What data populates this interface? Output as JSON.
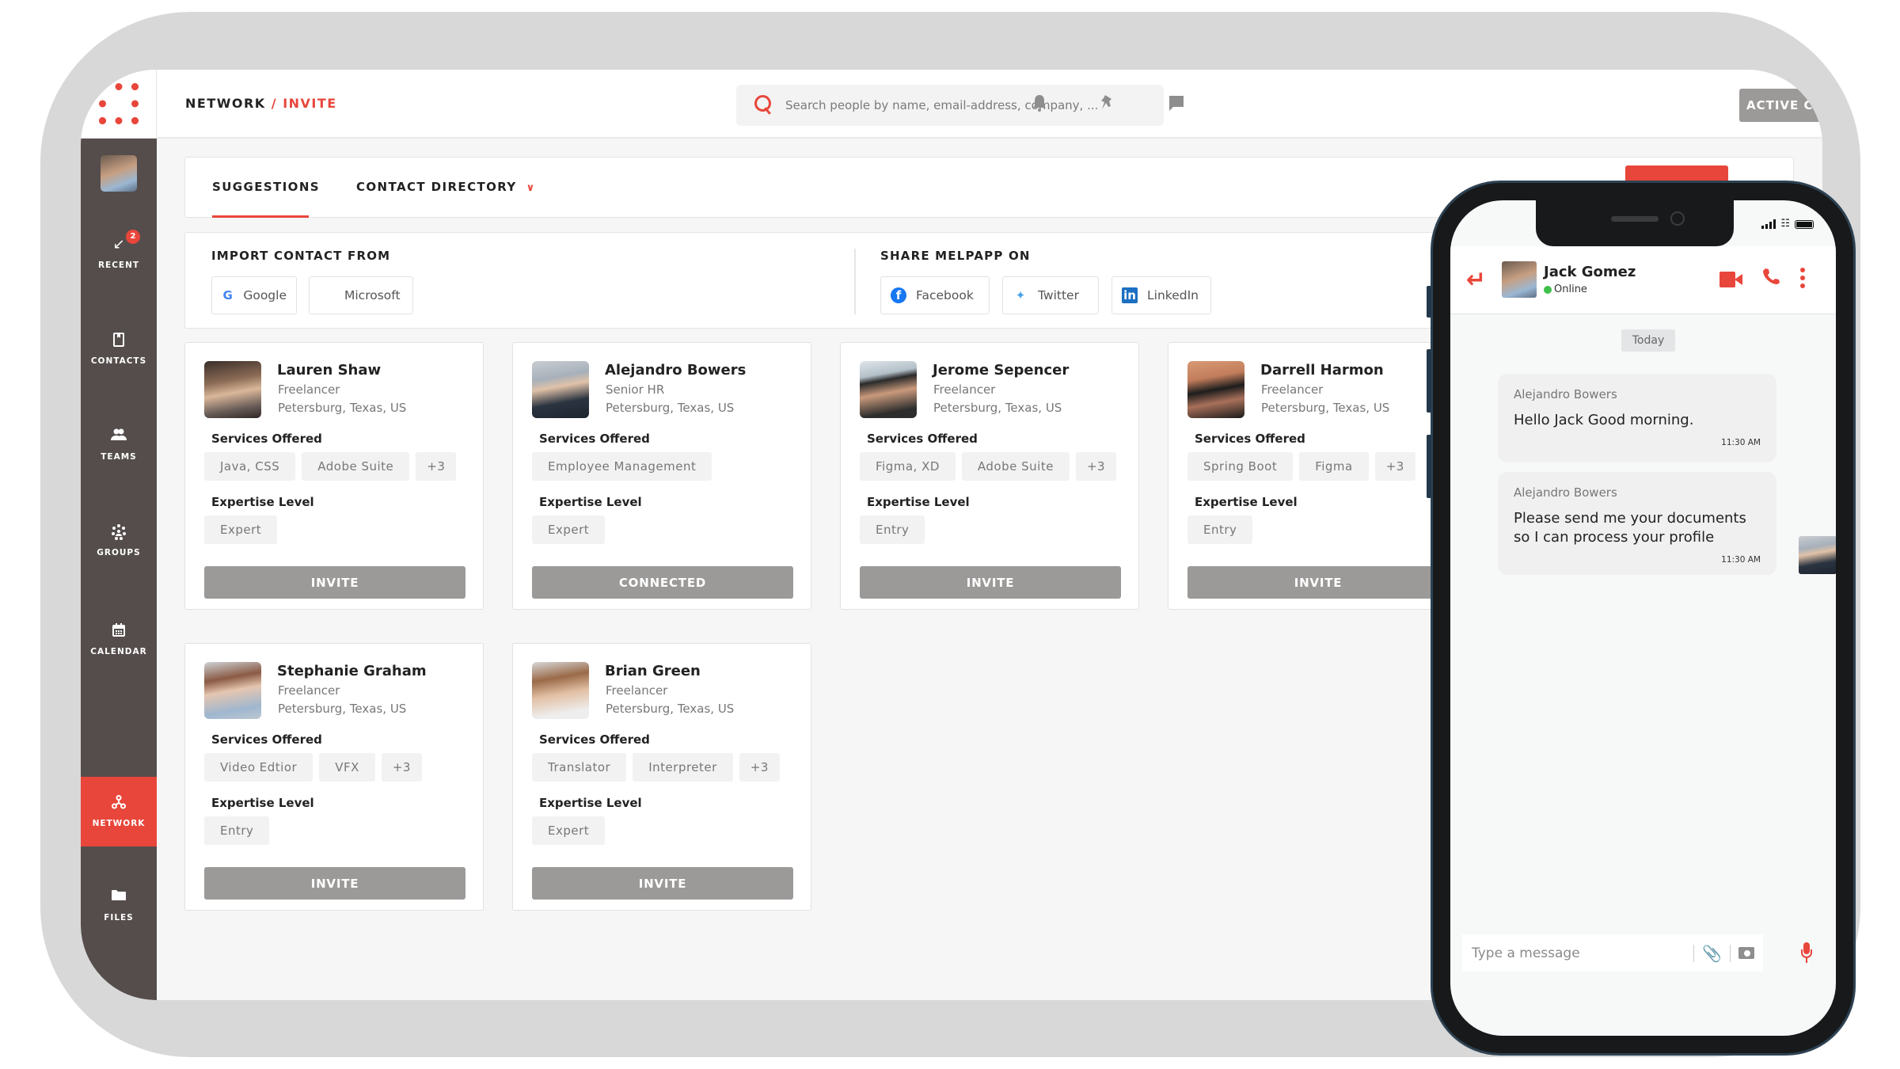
{
  "header": {
    "breadcrumb": {
      "section": "NETWORK",
      "separator": "/",
      "current": "INVITE"
    },
    "search": {
      "placeholder": "Search people by name, email-address, company, ..."
    },
    "icons": [
      "bell-icon",
      "pin-icon",
      "chat-icon"
    ],
    "active_calls_label": "ACTIVE CALLS"
  },
  "sidebar": {
    "items": [
      {
        "label": "RECENT",
        "icon": "recent-call-icon",
        "badge": "2"
      },
      {
        "label": "CONTACTS",
        "icon": "contacts-book-icon"
      },
      {
        "label": "TEAMS",
        "icon": "teams-icon"
      },
      {
        "label": "GROUPS",
        "icon": "groups-icon"
      },
      {
        "label": "CALENDAR",
        "icon": "calendar-icon"
      },
      {
        "label": "NETWORK",
        "icon": "network-icon",
        "active": true
      },
      {
        "label": "FILES",
        "icon": "folder-icon"
      }
    ]
  },
  "tabs": [
    {
      "label": "SUGGESTIONS",
      "active": true
    },
    {
      "label": "CONTACT DIRECTORY",
      "has_dropdown": true
    }
  ],
  "import": {
    "title": "IMPORT CONTACT FROM",
    "sources": [
      "Google",
      "Microsoft"
    ]
  },
  "share": {
    "title": "SHARE MELPAPP ON",
    "targets": [
      "Facebook",
      "Twitter",
      "LinkedIn"
    ]
  },
  "labels": {
    "services": "Services Offered",
    "expertise": "Expertise Level"
  },
  "cards": [
    {
      "name": "Lauren Shaw",
      "role": "Freelancer",
      "location": "Petersburg, Texas, US",
      "services": [
        "Java, CSS",
        "Adobe Suite",
        "+3"
      ],
      "level": "Expert",
      "action": "INVITE"
    },
    {
      "name": "Alejandro Bowers",
      "role": "Senior HR",
      "location": "Petersburg, Texas, US",
      "services": [
        "Employee Management"
      ],
      "level": "Expert",
      "action": "CONNECTED"
    },
    {
      "name": "Jerome Sepencer",
      "role": "Freelancer",
      "location": "Petersburg, Texas, US",
      "services": [
        "Figma, XD",
        "Adobe Suite",
        "+3"
      ],
      "level": "Entry",
      "action": "INVITE"
    },
    {
      "name": "Darrell Harmon",
      "role": "Freelancer",
      "location": "Petersburg, Texas, US",
      "services": [
        "Spring Boot",
        "Figma",
        "+3"
      ],
      "level": "Entry",
      "action": "INVITE"
    },
    {
      "name": "Stephanie Graham",
      "role": "Freelancer",
      "location": "Petersburg, Texas, US",
      "services": [
        "Video Edtior",
        "VFX",
        "+3"
      ],
      "level": "Entry",
      "action": "INVITE"
    },
    {
      "name": "Brian Green",
      "role": "Freelancer",
      "location": "Petersburg, Texas, US",
      "services": [
        "Translator",
        "Interpreter",
        "+3"
      ],
      "level": "Expert",
      "action": "INVITE"
    }
  ],
  "chat": {
    "contact_name": "Jack Gomez",
    "status": "Online",
    "date_label": "Today",
    "messages": [
      {
        "from": "Alejandro Bowers",
        "text": "Hello Jack Good morning.",
        "time": "11:30 AM"
      },
      {
        "from": "Alejandro Bowers",
        "text": "Please send me your documents so I can process your profile",
        "time": "11:30 AM"
      }
    ],
    "composer_placeholder": "Type a message"
  },
  "colors": {
    "accent": "#e8463a",
    "sidebar": "#554d4c",
    "button_gray": "#9c9a99",
    "online": "#3fc04a"
  }
}
